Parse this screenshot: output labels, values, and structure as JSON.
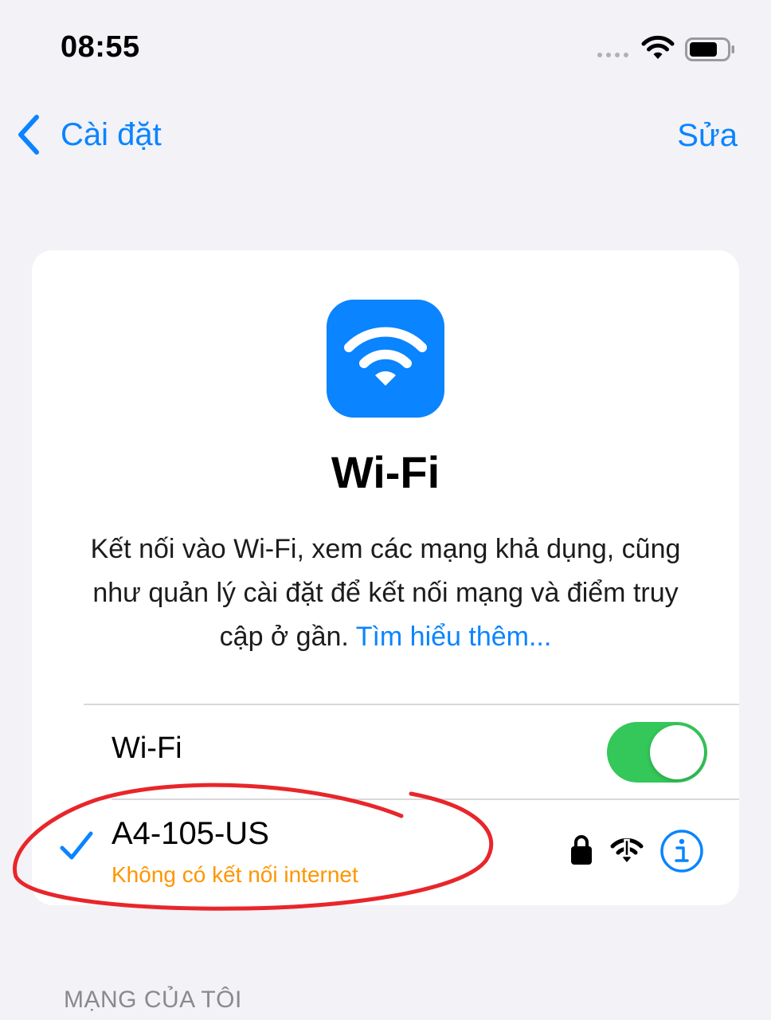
{
  "status_bar": {
    "time": "08:55"
  },
  "nav": {
    "back_label": "Cài đặt",
    "edit_label": "Sửa"
  },
  "header_card": {
    "title": "Wi-Fi",
    "description": "Kết nối vào Wi-Fi, xem các mạng khả dụng, cũng như quản lý cài đặt để kết nối mạng và điểm truy cập ở gần.",
    "learn_more": "Tìm hiểu thêm..."
  },
  "wifi_toggle": {
    "label": "Wi-Fi",
    "on": true
  },
  "connected_network": {
    "name": "A4-105-US",
    "status": "Không có kết nối internet",
    "icons": [
      "checkmark-icon",
      "lock-icon",
      "wifi-no-internet-icon",
      "info-icon"
    ]
  },
  "sections": {
    "my_networks": "MẠNG CỦA TÔI"
  },
  "colors": {
    "background": "#f2f2f7",
    "accent": "#0a84ff",
    "toggle_on": "#34c759",
    "warning": "#ff9500",
    "annotation": "#e8262a"
  }
}
